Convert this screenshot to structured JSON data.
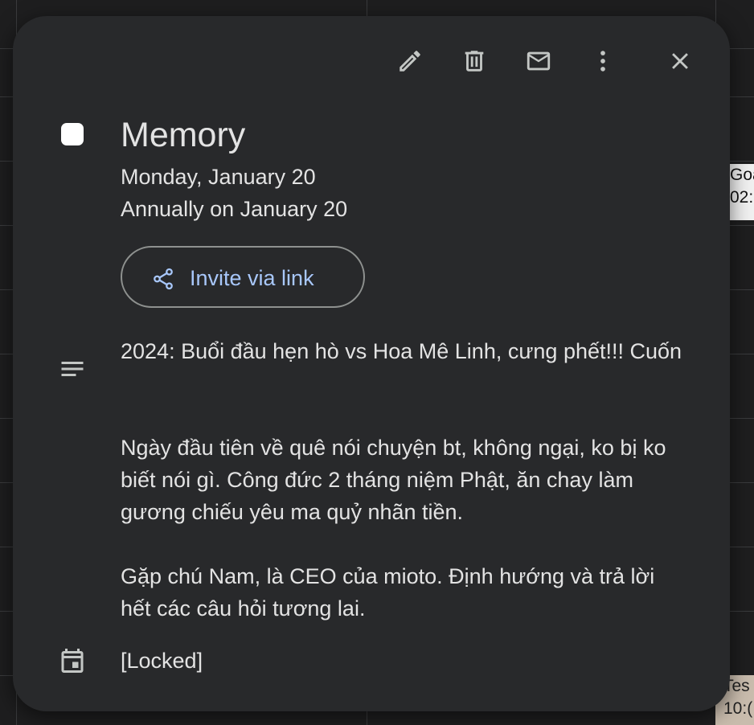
{
  "background_events": {
    "goal": {
      "line1": "Goa",
      "line2": "02:"
    },
    "test": {
      "line1": "Tes",
      "line2": "10:("
    }
  },
  "toolbar": {
    "edit_icon": "pencil-icon",
    "delete_icon": "trash-icon",
    "email_icon": "mail-icon",
    "more_icon": "more-vert-icon",
    "close_icon": "close-icon"
  },
  "event": {
    "color": "#ffffff",
    "title": "Memory",
    "date": "Monday, January 20",
    "recurrence": "Annually on January 20",
    "invite_label": "Invite via link",
    "description": [
      "2024: Buổi đầu hẹn hò vs Hoa Mê Linh, cưng phết!!! Cuốn",
      "Ngày đầu tiên về quê nói chuyện bt, không ngại, ko bị ko",
      "biết nói gì.  Công đức 2 tháng niệm Phật, ăn chay làm",
      "gương chiếu yêu ma quỷ nhãn tiền.",
      "Gặp chú Nam, là CEO của mioto. Định hướng và trả lời",
      "hết các câu hỏi tương lai."
    ],
    "calendar_name": "[Locked]"
  },
  "colors": {
    "card_bg": "#28292b",
    "text": "#e3e3e3",
    "link": "#a8c7fa",
    "icon": "#c4c7c5"
  }
}
